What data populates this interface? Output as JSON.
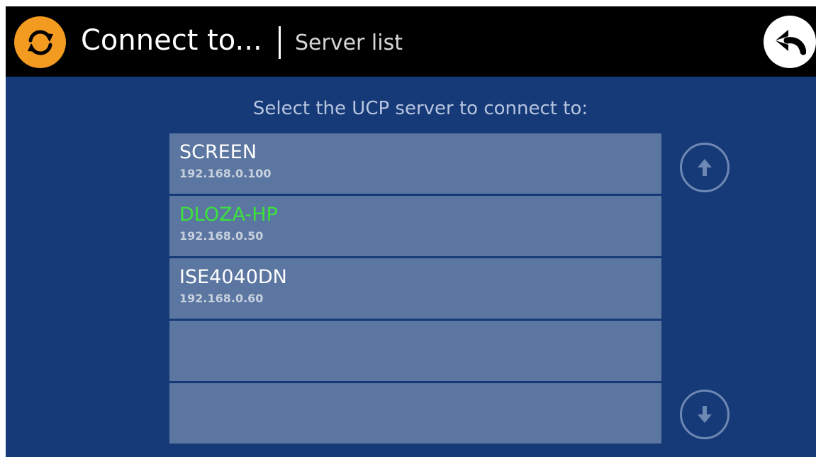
{
  "header": {
    "title": "Connect to...",
    "subtitle": "Server list",
    "app_icon": "refresh-icon",
    "back_icon": "back-arrow-icon"
  },
  "prompt": "Select the UCP server to connect to:",
  "servers": [
    {
      "name": "SCREEN",
      "ip": "192.168.0.100",
      "active": false
    },
    {
      "name": "DLOZA-HP",
      "ip": "192.168.0.50",
      "active": true
    },
    {
      "name": "ISE4040DN",
      "ip": "192.168.0.60",
      "active": false
    },
    {
      "name": "",
      "ip": "",
      "active": false
    },
    {
      "name": "",
      "ip": "",
      "active": false
    }
  ],
  "scroll": {
    "up_icon": "arrow-up-icon",
    "down_icon": "arrow-down-icon"
  },
  "colors": {
    "background": "#163a78",
    "header": "#000000",
    "accent": "#f39a21",
    "list_item": "#5b76a0",
    "active_name": "#3be33b"
  }
}
